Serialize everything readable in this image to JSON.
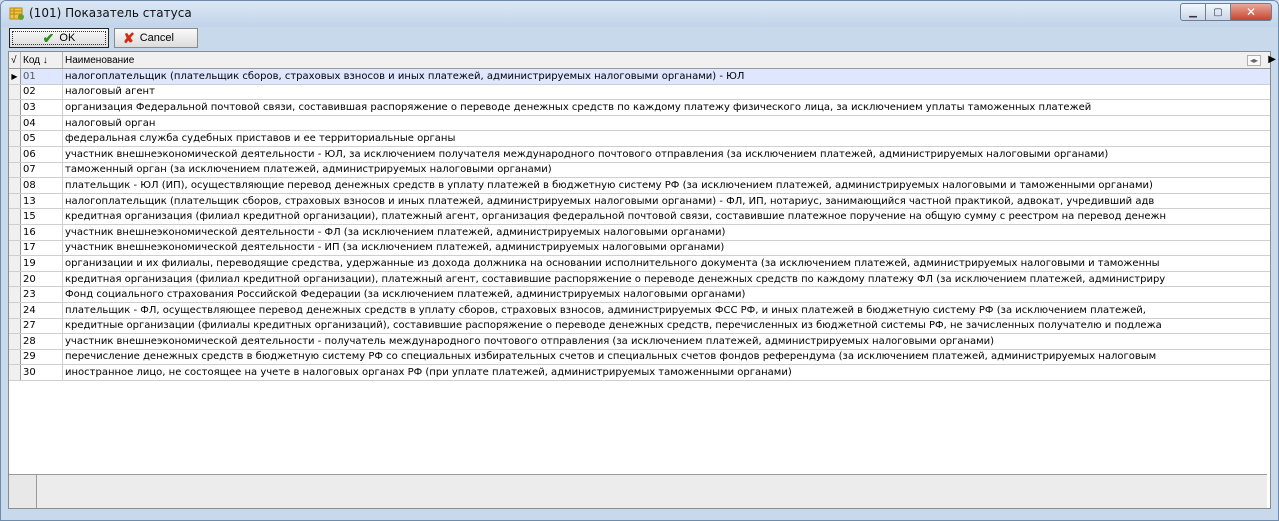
{
  "window": {
    "title": "(101) Показатель статуса",
    "controls": [
      "minimize-icon",
      "maximize-icon",
      "close-icon"
    ]
  },
  "toolbar": {
    "ok_label": "OK",
    "cancel_label": "Cancel"
  },
  "grid": {
    "columns": [
      "Код",
      "Наименование"
    ],
    "selected_index": 0,
    "rows": [
      {
        "code": "01",
        "name": "налогоплательщик (плательщик сборов, страховых взносов и иных платежей, администрируемых налоговыми органами) - ЮЛ"
      },
      {
        "code": "02",
        "name": "налоговый агент"
      },
      {
        "code": "03",
        "name": "организация Федеральной почтовой связи, составившая распоряжение о переводе денежных средств по каждому платежу физического лица, за исключением уплаты таможенных платежей"
      },
      {
        "code": "04",
        "name": "налоговый орган"
      },
      {
        "code": "05",
        "name": "федеральная служба судебных приставов и ее территориальные органы"
      },
      {
        "code": "06",
        "name": "участник внешнеэкономической деятельности - ЮЛ, за исключением получателя международного почтового отправления (за исключением платежей, администрируемых налоговыми органами)"
      },
      {
        "code": "07",
        "name": "таможенный орган (за исключением платежей, администрируемых налоговыми органами)"
      },
      {
        "code": "08",
        "name": "плательщик - ЮЛ (ИП), осуществляющие перевод денежных средств в уплату платежей в бюджетную систему РФ (за исключением платежей, администрируемых налоговыми и таможенными органами)"
      },
      {
        "code": "13",
        "name": "налогоплательщик (плательщик сборов, страховых взносов и иных платежей, администрируемых налоговыми органами) - ФЛ, ИП, нотариус, занимающийся частной практикой, адвокат, учредивший адв"
      },
      {
        "code": "15",
        "name": "кредитная организация (филиал кредитной организации), платежный агент, организация федеральной почтовой связи, составившие платежное поручение на общую сумму с реестром на перевод денежн"
      },
      {
        "code": "16",
        "name": "участник внешнеэкономической деятельности - ФЛ (за исключением платежей, администрируемых налоговыми органами)"
      },
      {
        "code": "17",
        "name": "участник внешнеэкономической деятельности - ИП (за исключением платежей, администрируемых налоговыми органами)"
      },
      {
        "code": "19",
        "name": "организации и их филиалы, переводящие средства, удержанные из дохода должника на основании исполнительного документа (за исключением платежей, администрируемых налоговыми и таможенны"
      },
      {
        "code": "20",
        "name": "кредитная организация (филиал кредитной организации), платежный агент, составившие распоряжение о переводе денежных средств по каждому платежу ФЛ (за исключением платежей, администриру"
      },
      {
        "code": "23",
        "name": "Фонд социального страхования Российской Федерации (за исключением платежей, администрируемых налоговыми органами)"
      },
      {
        "code": "24",
        "name": "плательщик - ФЛ, осуществляющее перевод денежных средств в уплату сборов, страховых взносов, администрируемых ФСС РФ, и иных платежей в бюджетную систему РФ (за исключением платежей,"
      },
      {
        "code": "27",
        "name": "кредитные организации (филиалы кредитных организаций), составившие распоряжение о переводе денежных средств, перечисленных из бюджетной системы РФ, не зачисленных получателю и подлежа"
      },
      {
        "code": "28",
        "name": "участник внешнеэкономической деятельности - получатель международного почтового отправления (за исключением платежей, администрируемых налоговыми органами)"
      },
      {
        "code": "29",
        "name": "перечисление денежных средств в бюджетную систему РФ со специальных избирательных счетов и специальных счетов фондов референдума (за исключением платежей, администрируемых налоговым"
      },
      {
        "code": "30",
        "name": "иностранное лицо, не состоящее на учете в налоговых органах РФ (при уплате платежей, администрируемых таможенными органами)"
      }
    ]
  }
}
